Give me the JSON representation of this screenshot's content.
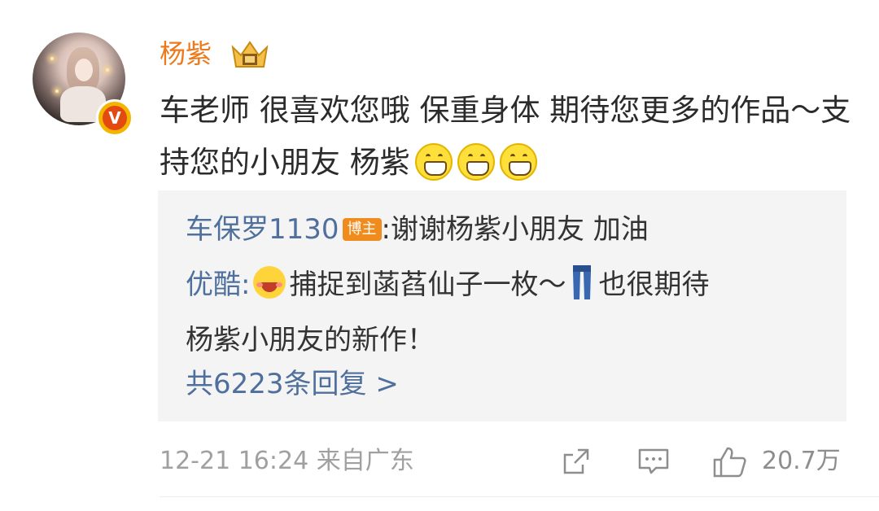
{
  "comment": {
    "username": "杨紫",
    "text": "车老师 很喜欢您哦 保重身体 期待您更多的作品～支持您的小朋友 杨紫",
    "avatar_badge": "V",
    "icons": [
      "crown-badge-icon",
      "grin-emoji-icon",
      "grin-emoji-icon",
      "grin-emoji-icon"
    ]
  },
  "replies": {
    "items": [
      {
        "author": "车保罗1130",
        "author_tag": "博主",
        "separator": ":",
        "text": "谢谢杨紫小朋友 加油"
      },
      {
        "author": "优酷",
        "separator": ":",
        "text_before_icon": "捕捉到菡萏仙子一枚～",
        "text_after_icon": "也很期待",
        "text_line2": "杨紫小朋友的新作！"
      }
    ],
    "more_label": "共6223条回复 >"
  },
  "footer": {
    "time": "12-21 16:24",
    "source": "来自广东",
    "likes": "20.7万",
    "icons": [
      "share-icon",
      "comment-icon",
      "like-icon"
    ]
  },
  "colors": {
    "username": "#ec7a1c",
    "link_blue": "#4f6f9c",
    "reply_bg": "#f4f4f4",
    "meta_gray": "#a0a0a0"
  }
}
